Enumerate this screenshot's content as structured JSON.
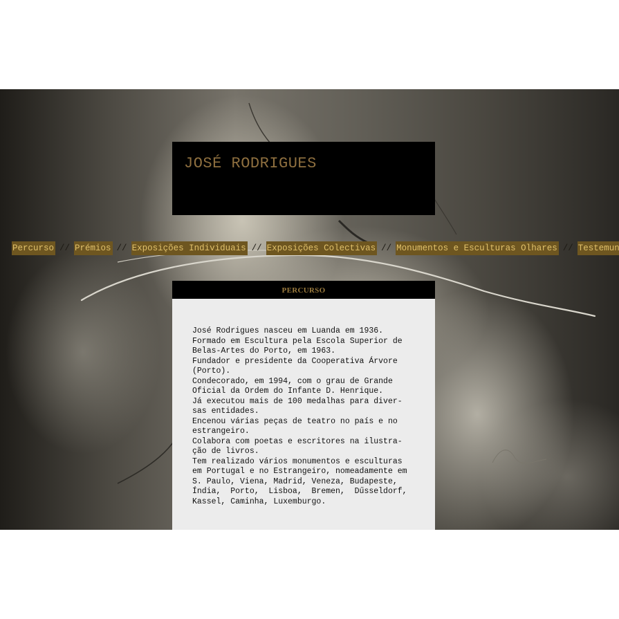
{
  "site": {
    "title": "JOSÉ RODRIGUES"
  },
  "nav": {
    "separator": "//",
    "items": [
      "Percurso",
      "Prémios",
      "Exposições Individuais",
      "Exposições Colectivas",
      "Monumentos e Esculturas Olhares",
      "Testemunho"
    ]
  },
  "section": {
    "title": "PERCURSO"
  },
  "bio": {
    "lines": [
      "José Rodrigues nasceu em Luanda em 1936.",
      "Formado em Escultura pela Escola Superior de",
      "Belas-Artes do Porto, em 1963.",
      "Fundador e presidente da Cooperativa Árvore",
      "(Porto).",
      "Condecorado, em 1994, com o grau de Grande",
      "Oficial da Ordem do Infante D. Henrique.",
      "Já executou mais de 100 medalhas para diver-",
      "sas entidades.",
      "Encenou várias peças de teatro no país e no",
      "estrangeiro.",
      "Colabora com poetas e escritores na ilustra-",
      "ção de livros.",
      "Tem realizado vários monumentos e esculturas",
      "em Portugal e no Estrangeiro, nomeadamente em",
      "S. Paulo, Viena, Madrid, Veneza, Budapeste,",
      "Índia,  Porto,  Lisboa,  Bremen,  Dűsseldorf,",
      "Kassel, Caminha, Luxemburgo."
    ]
  },
  "colors": {
    "title": "#8e6f3f",
    "nav_bg": "#6e5620",
    "nav_text": "#e0c06a",
    "header_bg": "#000000",
    "content_bg": "#ececec"
  }
}
